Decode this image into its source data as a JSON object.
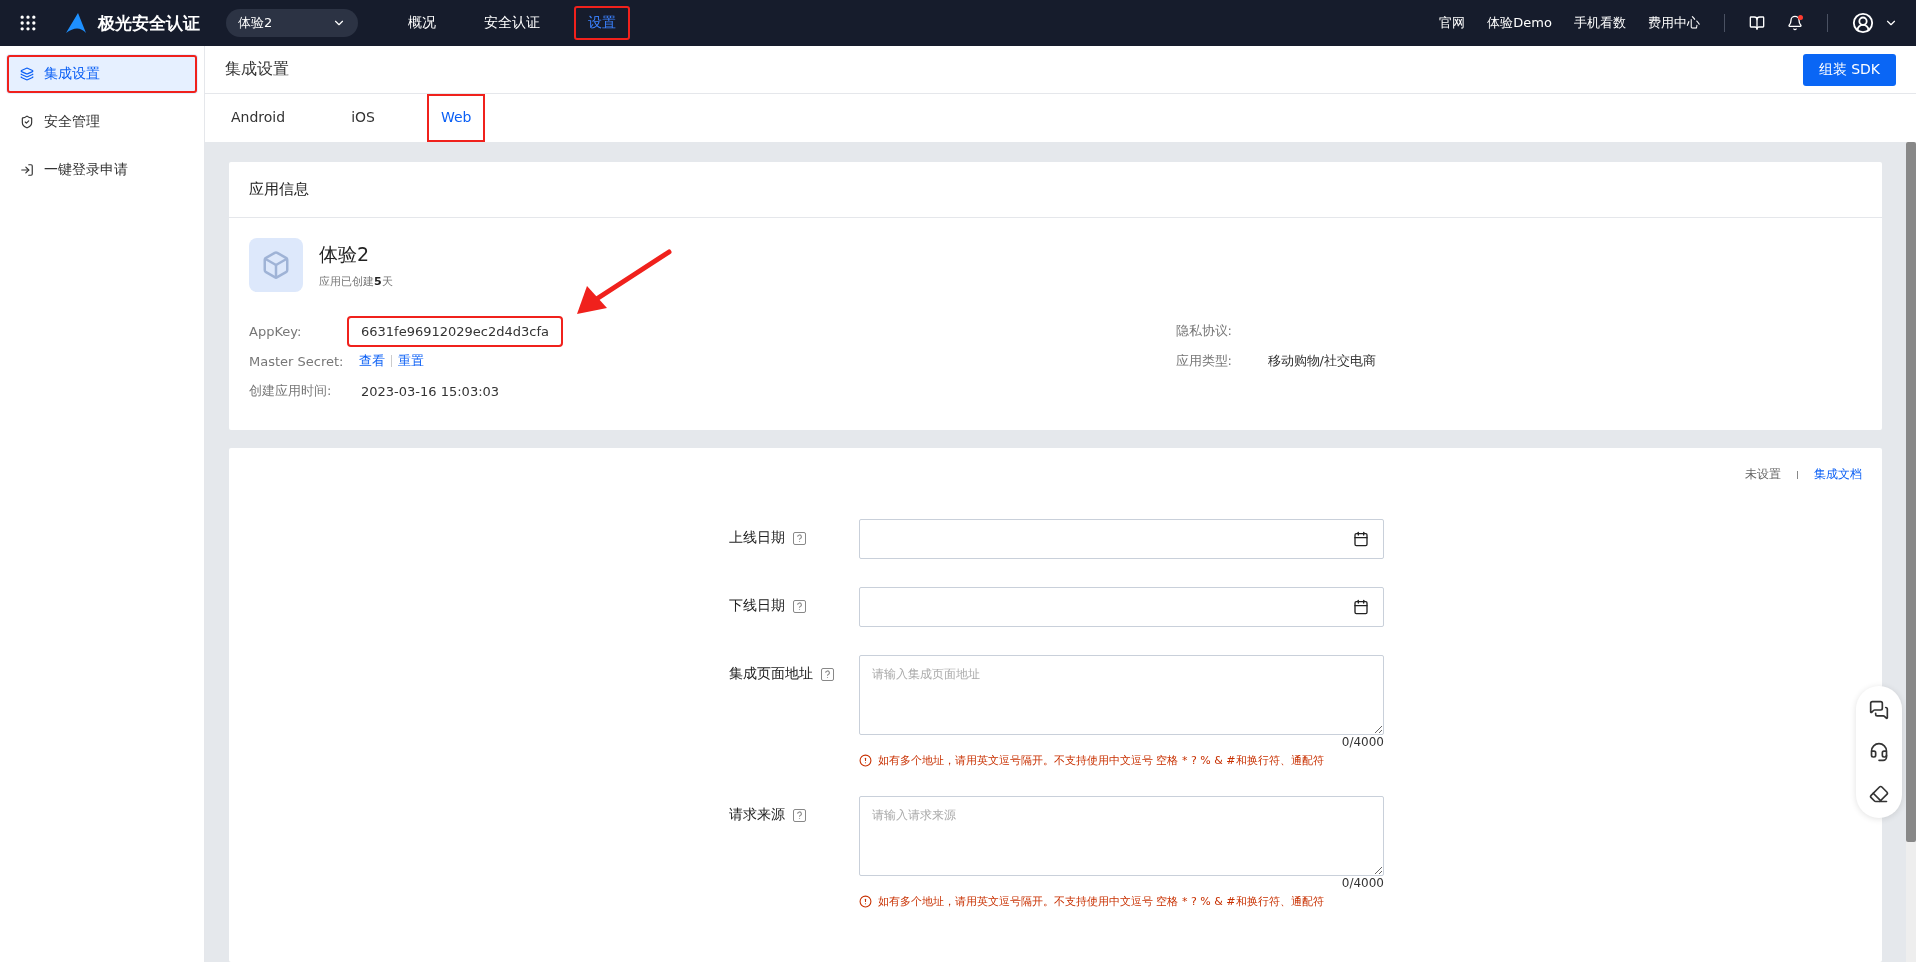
{
  "topbar": {
    "brand": "极光安全认证",
    "app_select": "体验2",
    "nav": [
      {
        "label": "概况",
        "selected": false,
        "highlighted": false
      },
      {
        "label": "安全认证",
        "selected": false,
        "highlighted": false
      },
      {
        "label": "设置",
        "selected": true,
        "highlighted": true
      }
    ],
    "links": [
      "官网",
      "体验Demo",
      "手机看数",
      "费用中心"
    ],
    "notification_dot": true
  },
  "sidebar": {
    "items": [
      {
        "label": "集成设置",
        "selected": true,
        "highlighted": true
      },
      {
        "label": "安全管理",
        "selected": false,
        "highlighted": false
      },
      {
        "label": "一键登录申请",
        "selected": false,
        "highlighted": false
      }
    ]
  },
  "page_header": {
    "title": "集成设置",
    "button": "组装 SDK"
  },
  "tabs": [
    {
      "label": "Android",
      "selected": false,
      "highlighted": false
    },
    {
      "label": "iOS",
      "selected": false,
      "highlighted": false
    },
    {
      "label": "Web",
      "selected": true,
      "highlighted": true
    }
  ],
  "app_info": {
    "title": "应用信息",
    "app_name": "体验2",
    "created_note": "应用已创建**5**天",
    "left_fields": [
      {
        "label": "AppKey:",
        "kind": "text",
        "value": "6631fe96912029ec2d4d3cfa",
        "highlighted": true
      },
      {
        "label": "Master Secret:",
        "kind": "links",
        "links": [
          "查看",
          "重置"
        ]
      },
      {
        "label": "创建应用时间:",
        "kind": "text",
        "value": "2023-03-16 15:03:03"
      }
    ],
    "right_fields": [
      {
        "label": "隐私协议:"
      },
      {
        "label": "应用类型:",
        "value": "移动购物/社交电商"
      }
    ],
    "annotation_arrow": true
  },
  "web_settings": {
    "status": "未设置",
    "doc_link": "集成文档",
    "fields": [
      {
        "label": "上线日期",
        "kind": "date"
      },
      {
        "label": "下线日期",
        "kind": "date"
      },
      {
        "label": "集成页面地址",
        "kind": "textarea",
        "placeholder": "请输入集成页面地址",
        "counter": "0/4000",
        "hint": "如有多个地址，请用英文逗号隔开。不支持使用中文逗号 空格 * ? % & #和换行符、通配符"
      },
      {
        "label": "请求来源",
        "kind": "textarea",
        "placeholder": "请输入请求来源",
        "counter": "0/4000",
        "hint": "如有多个地址，请用英文逗号隔开。不支持使用中文逗号 空格 * ? % & #和换行符、通配符"
      }
    ]
  }
}
